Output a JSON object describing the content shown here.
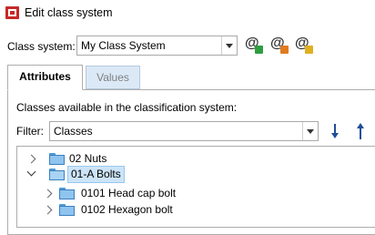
{
  "window": {
    "title": "Edit class system"
  },
  "class_system": {
    "label": "Class system:",
    "value": "My Class System"
  },
  "toolbar": {
    "icons": [
      {
        "name": "add-class-system-icon",
        "badge_color": "#2e9e3e"
      },
      {
        "name": "edit-class-system-icon",
        "badge_color": "#e07b20"
      },
      {
        "name": "rename-class-system-icon",
        "badge_color": "#e0b020"
      }
    ]
  },
  "tabs": [
    {
      "label": "Attributes",
      "active": true
    },
    {
      "label": "Values",
      "active": false
    }
  ],
  "classes_section": {
    "label": "Classes available in the classification system:",
    "filter_label": "Filter:",
    "filter_value": "Classes"
  },
  "tree": {
    "nodes": [
      {
        "label": "02 Nuts",
        "level": 0,
        "expanded": false,
        "selected": false
      },
      {
        "label": "01-A Bolts",
        "level": 0,
        "expanded": true,
        "selected": true
      },
      {
        "label": "0101 Head cap bolt",
        "level": 1,
        "expanded": false,
        "selected": false
      },
      {
        "label": "0102 Hexagon bolt",
        "level": 1,
        "expanded": false,
        "selected": false
      }
    ]
  },
  "colors": {
    "selection": "#cce4f7",
    "folder": "#8ec4ee",
    "arrow": "#1f4e99"
  }
}
